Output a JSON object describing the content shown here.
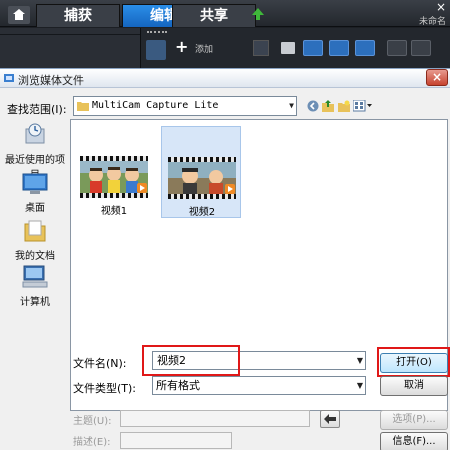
{
  "app": {
    "tabs": [
      {
        "label": "捕获",
        "active": false
      },
      {
        "label": "编辑",
        "active": true
      },
      {
        "label": "共享",
        "active": false
      }
    ],
    "status_text": "未命名",
    "close_glyph": "×",
    "toolbar_add_label": "添加",
    "toolbar_plus_glyph": "+"
  },
  "dialog": {
    "title": "浏览媒体文件",
    "close_glyph": "×",
    "look_in_label": "查找范围(I):",
    "look_in_value": "MultiCam Capture Lite",
    "places": [
      {
        "label": "最近使用的项目",
        "icon": "recent-items-icon"
      },
      {
        "label": "桌面",
        "icon": "desktop-icon"
      },
      {
        "label": "我的文档",
        "icon": "my-documents-icon"
      },
      {
        "label": "计算机",
        "icon": "computer-icon"
      }
    ],
    "files": [
      {
        "name": "视频1",
        "selected": false
      },
      {
        "name": "视频2",
        "selected": true
      }
    ],
    "filename_label": "文件名(N):",
    "filename_value": "视频2",
    "filetype_label": "文件类型(T):",
    "filetype_value": "所有格式",
    "open_button": "打开(O)",
    "cancel_button": "取消",
    "subject_label": "主题(U):",
    "description_label": "描述(E):",
    "options_button": "选项(P)...",
    "info_button": "信息(F)..."
  },
  "colors": {
    "accent_blue": "#1f7ad6",
    "highlight_red": "#e01818",
    "play_orange": "#f08a24"
  }
}
